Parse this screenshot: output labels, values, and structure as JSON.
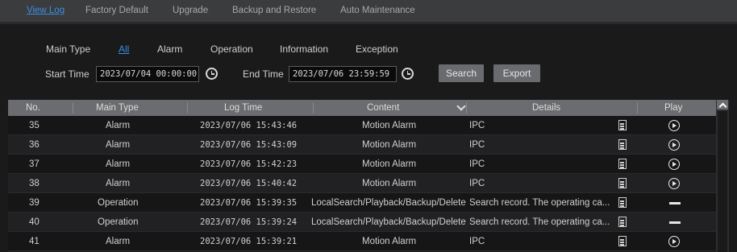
{
  "tabs": [
    {
      "label": "View Log",
      "active": true
    },
    {
      "label": "Factory Default",
      "active": false
    },
    {
      "label": "Upgrade",
      "active": false
    },
    {
      "label": "Backup and Restore",
      "active": false
    },
    {
      "label": "Auto Maintenance",
      "active": false
    }
  ],
  "filter": {
    "main_type_label": "Main Type",
    "types": [
      "All",
      "Alarm",
      "Operation",
      "Information",
      "Exception"
    ],
    "selected_type": "All",
    "start_time_label": "Start Time",
    "start_time_value": "2023/07/04 00:00:00",
    "end_time_label": "End Time",
    "end_time_value": "2023/07/06 23:59:59",
    "search_label": "Search",
    "export_label": "Export"
  },
  "table": {
    "headers": [
      "No.",
      "Main Type",
      "Log Time",
      "Content",
      "Details",
      "Play"
    ],
    "rows": [
      {
        "no": "35",
        "type": "Alarm",
        "time": "2023/07/06 15:43:46",
        "content": "Motion Alarm",
        "details": "IPC",
        "play": "play-icon"
      },
      {
        "no": "36",
        "type": "Alarm",
        "time": "2023/07/06 15:43:09",
        "content": "Motion Alarm",
        "details": "IPC",
        "play": "play-icon"
      },
      {
        "no": "37",
        "type": "Alarm",
        "time": "2023/07/06 15:42:23",
        "content": "Motion Alarm",
        "details": "IPC",
        "play": "play-icon"
      },
      {
        "no": "38",
        "type": "Alarm",
        "time": "2023/07/06 15:40:42",
        "content": "Motion Alarm",
        "details": "IPC",
        "play": "play-icon"
      },
      {
        "no": "39",
        "type": "Operation",
        "time": "2023/07/06 15:39:35",
        "content": "LocalSearch/Playback/Backup/Delete",
        "details": "Search record. The operating ca...",
        "play": "dash-icon"
      },
      {
        "no": "40",
        "type": "Operation",
        "time": "2023/07/06 15:39:24",
        "content": "LocalSearch/Playback/Backup/Delete",
        "details": "Search record. The operating ca...",
        "play": "dash-icon"
      },
      {
        "no": "41",
        "type": "Alarm",
        "time": "2023/07/06 15:39:21",
        "content": "Motion Alarm",
        "details": "IPC",
        "play": "play-icon"
      }
    ]
  },
  "colors": {
    "accent": "#3a8fe0",
    "header_bg": "#6b6c6f",
    "tabbar_bg": "#3b3c3e",
    "page_bg": "#1a1a1b"
  }
}
